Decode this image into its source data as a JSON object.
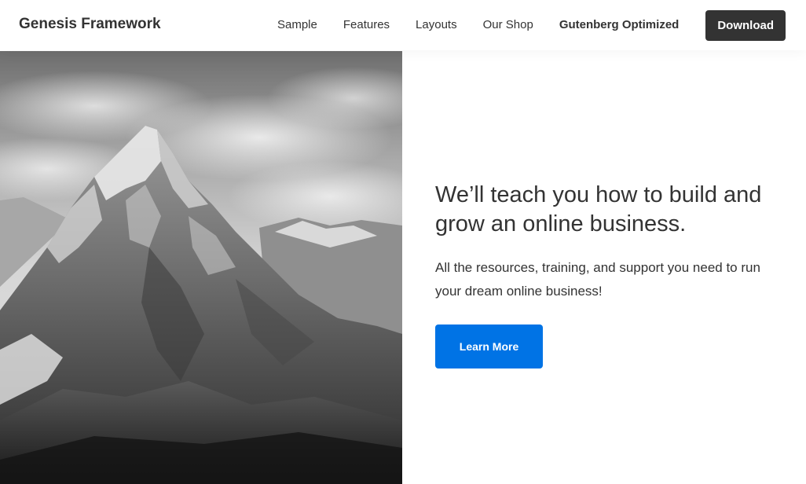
{
  "header": {
    "site_title": "Genesis Framework",
    "nav": [
      {
        "label": "Sample"
      },
      {
        "label": "Features"
      },
      {
        "label": "Layouts"
      },
      {
        "label": "Our Shop"
      },
      {
        "label": "Gutenberg Optimized"
      }
    ],
    "download_label": "Download"
  },
  "hero": {
    "image_icon": "mountain-photo",
    "title": "We’ll teach you how to build and grow an online business.",
    "text": "All the resources, training, and support you need to run your dream online business!",
    "button_label": "Learn More"
  },
  "colors": {
    "text": "#333333",
    "accent": "#0073e5",
    "download_bg": "#333333",
    "background": "#ffffff"
  }
}
